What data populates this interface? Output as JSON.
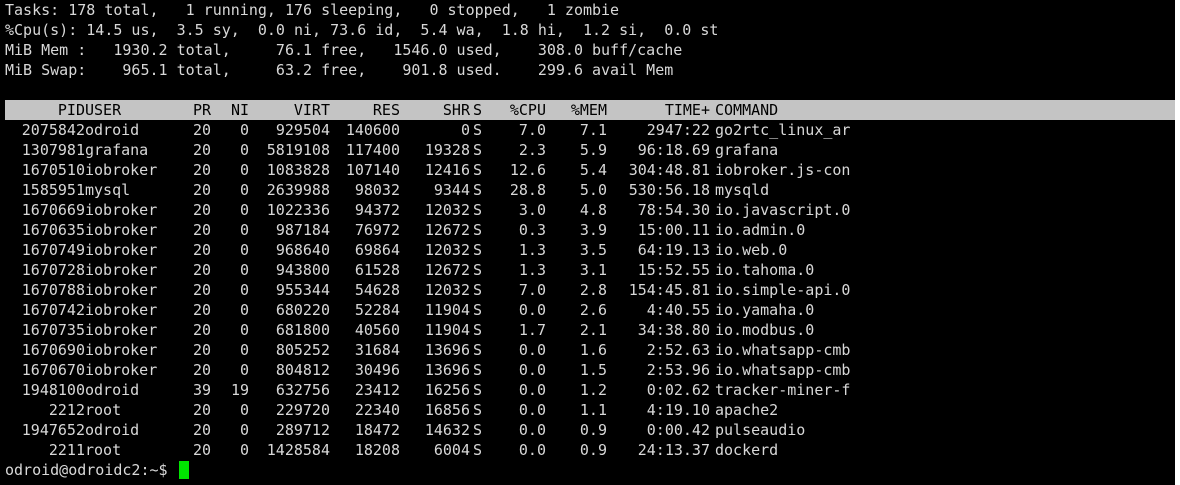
{
  "summary": [
    "Tasks: 178 total,   1 running, 176 sleeping,   0 stopped,   1 zombie",
    "%Cpu(s): 14.5 us,  3.5 sy,  0.0 ni, 73.6 id,  5.4 wa,  1.8 hi,  1.2 si,  0.0 st",
    "MiB Mem :   1930.2 total,     76.1 free,   1546.0 used,    308.0 buff/cache",
    "MiB Swap:    965.1 total,     63.2 free,    901.8 used.    299.6 avail Mem"
  ],
  "columns": {
    "pid": "PID",
    "user": "USER",
    "pr": "PR",
    "ni": "NI",
    "virt": "VIRT",
    "res": "RES",
    "shr": "SHR",
    "s": "S",
    "cpu": "%CPU",
    "mem": "%MEM",
    "time": "TIME+",
    "cmd": "COMMAND"
  },
  "processes": [
    {
      "pid": "2075842",
      "user": "odroid",
      "pr": "20",
      "ni": "0",
      "virt": "929504",
      "res": "140600",
      "shr": "0",
      "s": "S",
      "cpu": "7.0",
      "mem": "7.1",
      "time": "2947:22",
      "cmd": "go2rtc_linux_ar"
    },
    {
      "pid": "1307981",
      "user": "grafana",
      "pr": "20",
      "ni": "0",
      "virt": "5819108",
      "res": "117400",
      "shr": "19328",
      "s": "S",
      "cpu": "2.3",
      "mem": "5.9",
      "time": "96:18.69",
      "cmd": "grafana"
    },
    {
      "pid": "1670510",
      "user": "iobroker",
      "pr": "20",
      "ni": "0",
      "virt": "1083828",
      "res": "107140",
      "shr": "12416",
      "s": "S",
      "cpu": "12.6",
      "mem": "5.4",
      "time": "304:48.81",
      "cmd": "iobroker.js-con"
    },
    {
      "pid": "1585951",
      "user": "mysql",
      "pr": "20",
      "ni": "0",
      "virt": "2639988",
      "res": "98032",
      "shr": "9344",
      "s": "S",
      "cpu": "28.8",
      "mem": "5.0",
      "time": "530:56.18",
      "cmd": "mysqld"
    },
    {
      "pid": "1670669",
      "user": "iobroker",
      "pr": "20",
      "ni": "0",
      "virt": "1022336",
      "res": "94372",
      "shr": "12032",
      "s": "S",
      "cpu": "3.0",
      "mem": "4.8",
      "time": "78:54.30",
      "cmd": "io.javascript.0"
    },
    {
      "pid": "1670635",
      "user": "iobroker",
      "pr": "20",
      "ni": "0",
      "virt": "987184",
      "res": "76972",
      "shr": "12672",
      "s": "S",
      "cpu": "0.3",
      "mem": "3.9",
      "time": "15:00.11",
      "cmd": "io.admin.0"
    },
    {
      "pid": "1670749",
      "user": "iobroker",
      "pr": "20",
      "ni": "0",
      "virt": "968640",
      "res": "69864",
      "shr": "12032",
      "s": "S",
      "cpu": "1.3",
      "mem": "3.5",
      "time": "64:19.13",
      "cmd": "io.web.0"
    },
    {
      "pid": "1670728",
      "user": "iobroker",
      "pr": "20",
      "ni": "0",
      "virt": "943800",
      "res": "61528",
      "shr": "12672",
      "s": "S",
      "cpu": "1.3",
      "mem": "3.1",
      "time": "15:52.55",
      "cmd": "io.tahoma.0"
    },
    {
      "pid": "1670788",
      "user": "iobroker",
      "pr": "20",
      "ni": "0",
      "virt": "955344",
      "res": "54628",
      "shr": "12032",
      "s": "S",
      "cpu": "7.0",
      "mem": "2.8",
      "time": "154:45.81",
      "cmd": "io.simple-api.0"
    },
    {
      "pid": "1670742",
      "user": "iobroker",
      "pr": "20",
      "ni": "0",
      "virt": "680220",
      "res": "52284",
      "shr": "11904",
      "s": "S",
      "cpu": "0.0",
      "mem": "2.6",
      "time": "4:40.55",
      "cmd": "io.yamaha.0"
    },
    {
      "pid": "1670735",
      "user": "iobroker",
      "pr": "20",
      "ni": "0",
      "virt": "681800",
      "res": "40560",
      "shr": "11904",
      "s": "S",
      "cpu": "1.7",
      "mem": "2.1",
      "time": "34:38.80",
      "cmd": "io.modbus.0"
    },
    {
      "pid": "1670690",
      "user": "iobroker",
      "pr": "20",
      "ni": "0",
      "virt": "805252",
      "res": "31684",
      "shr": "13696",
      "s": "S",
      "cpu": "0.0",
      "mem": "1.6",
      "time": "2:52.63",
      "cmd": "io.whatsapp-cmb"
    },
    {
      "pid": "1670670",
      "user": "iobroker",
      "pr": "20",
      "ni": "0",
      "virt": "804812",
      "res": "30496",
      "shr": "13696",
      "s": "S",
      "cpu": "0.0",
      "mem": "1.5",
      "time": "2:53.96",
      "cmd": "io.whatsapp-cmb"
    },
    {
      "pid": "1948100",
      "user": "odroid",
      "pr": "39",
      "ni": "19",
      "virt": "632756",
      "res": "23412",
      "shr": "16256",
      "s": "S",
      "cpu": "0.0",
      "mem": "1.2",
      "time": "0:02.62",
      "cmd": "tracker-miner-f"
    },
    {
      "pid": "2212",
      "user": "root",
      "pr": "20",
      "ni": "0",
      "virt": "229720",
      "res": "22340",
      "shr": "16856",
      "s": "S",
      "cpu": "0.0",
      "mem": "1.1",
      "time": "4:19.10",
      "cmd": "apache2"
    },
    {
      "pid": "1947652",
      "user": "odroid",
      "pr": "20",
      "ni": "0",
      "virt": "289712",
      "res": "18472",
      "shr": "14632",
      "s": "S",
      "cpu": "0.0",
      "mem": "0.9",
      "time": "0:00.42",
      "cmd": "pulseaudio"
    },
    {
      "pid": "2211",
      "user": "root",
      "pr": "20",
      "ni": "0",
      "virt": "1428584",
      "res": "18208",
      "shr": "6004",
      "s": "S",
      "cpu": "0.0",
      "mem": "0.9",
      "time": "24:13.37",
      "cmd": "dockerd"
    }
  ],
  "prompt": "odroid@odroidc2:~$ ",
  "colors": {
    "background": "#000000",
    "foreground": "#d8d8d8",
    "header_bar": "#c4c4c4",
    "cursor": "#00e600"
  }
}
